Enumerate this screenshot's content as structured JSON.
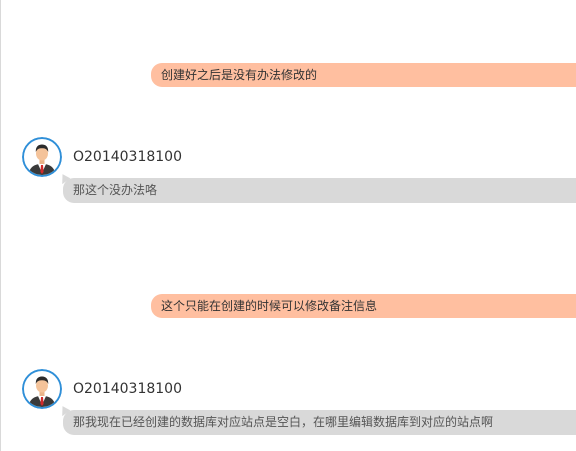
{
  "messages": [
    {
      "type": "outgoing",
      "text": "创建好之后是没有办法修改的"
    },
    {
      "type": "incoming",
      "username": "O20140318100",
      "text": "那这个没办法咯"
    },
    {
      "type": "outgoing",
      "text": "这个只能在创建的时候可以修改备注信息"
    },
    {
      "type": "incoming",
      "username": "O20140318100",
      "text": "那我现在已经创建的数据库对应站点是空白，在哪里编辑数据库到对应的站点啊"
    }
  ],
  "colors": {
    "outgoing_bubble": "#ffbfa0",
    "incoming_bubble": "#d9d9d9",
    "avatar_ring": "#2f8fd8"
  },
  "icons": {
    "avatar": "user-avatar-icon"
  }
}
